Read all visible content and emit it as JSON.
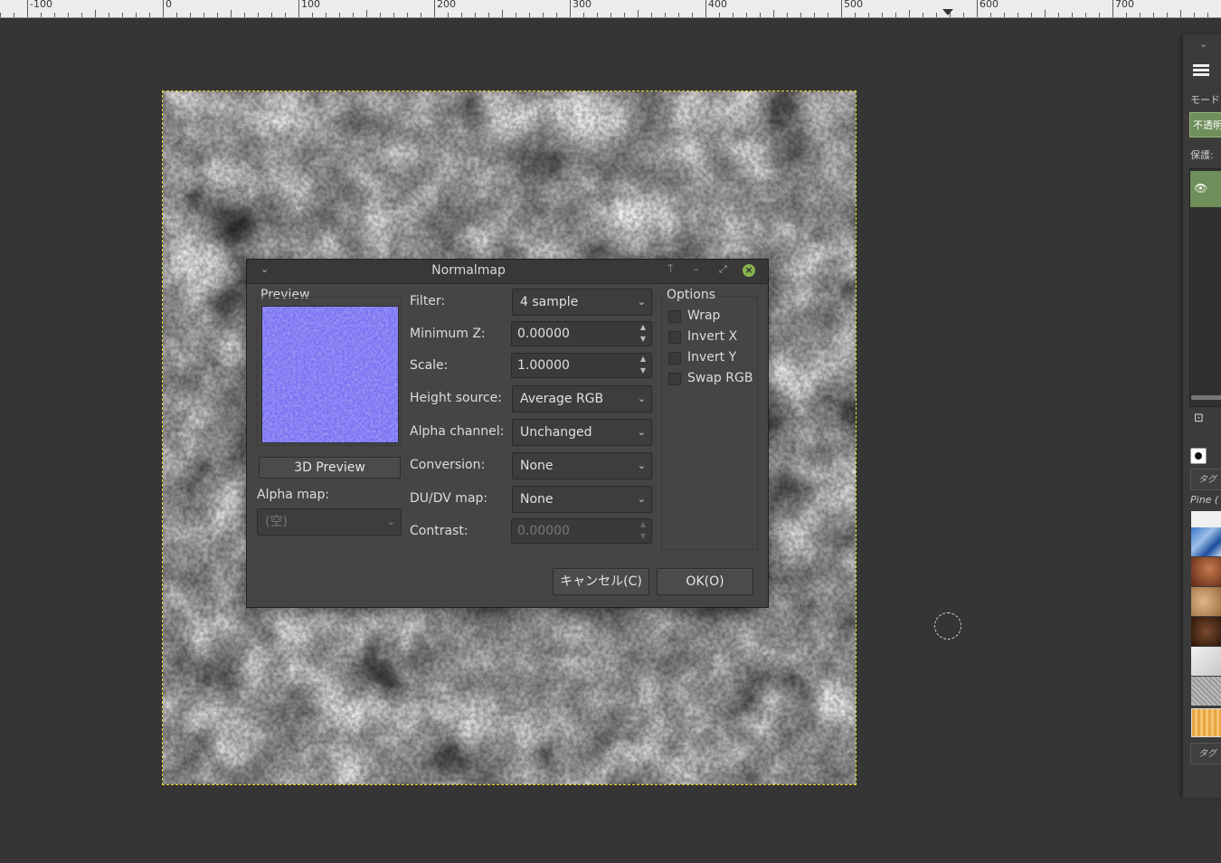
{
  "ruler": {
    "labels": [
      "-100",
      "0",
      "100",
      "200",
      "300",
      "400",
      "500",
      "600",
      "700"
    ]
  },
  "dialog": {
    "title": "Normalmap",
    "preview_label": "Preview",
    "preview_button": "3D Preview",
    "alpha_map_label": "Alpha map:",
    "alpha_map_value": "(空)",
    "fields": {
      "filter_label": "Filter:",
      "filter_value": "4 sample",
      "minz_label": "Minimum Z:",
      "minz_value": "0.00000",
      "scale_label": "Scale:",
      "scale_value": "1.00000",
      "height_label": "Height source:",
      "height_value": "Average RGB",
      "alpha_label": "Alpha channel:",
      "alpha_value": "Unchanged",
      "conversion_label": "Conversion:",
      "conversion_value": "None",
      "dudv_label": "DU/DV map:",
      "dudv_value": "None",
      "contrast_label": "Contrast:",
      "contrast_value": "0.00000"
    },
    "options": {
      "title": "Options",
      "wrap": "Wrap",
      "invert_x": "Invert X",
      "invert_y": "Invert Y",
      "swap_rgb": "Swap RGB"
    },
    "cancel_label": "キャンセル(C)",
    "ok_label": "OK(O)"
  },
  "dock": {
    "mode_label": "モード:",
    "opacity_label": "不透明",
    "protect_label": "保護:",
    "tag_placeholder": "タグ",
    "pattern_name": "Pine (",
    "tag_placeholder2": "タグ"
  },
  "colors": {
    "bg": "#353535",
    "dialog_bg": "#454545",
    "preview_fill": "#7a72f2",
    "accent_green": "#6f8f5a",
    "selection_border": "#e4d824"
  }
}
